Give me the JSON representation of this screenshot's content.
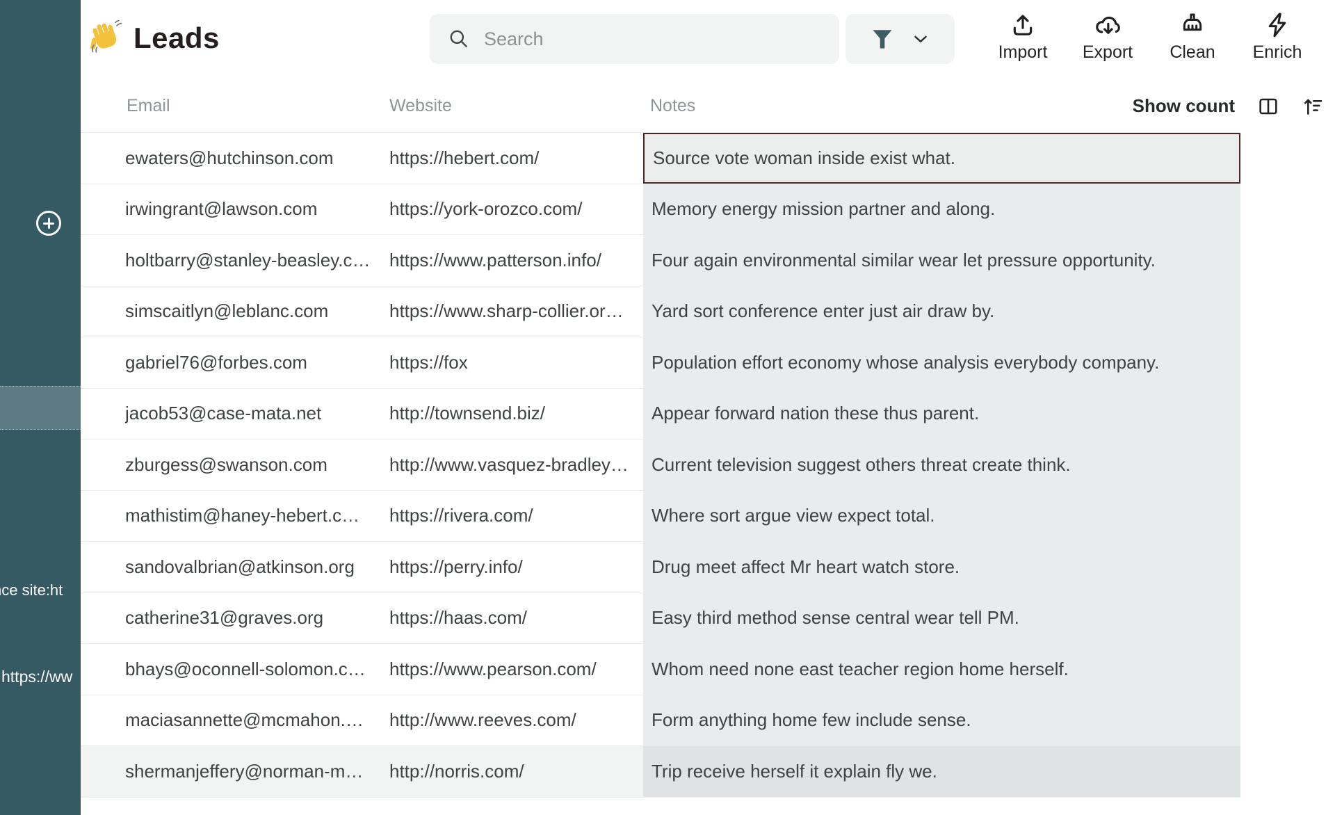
{
  "app": {
    "title": "Leads",
    "wave_icon": "waving-hand-emoji"
  },
  "sidebar": {
    "add_button": "plus-circle",
    "overflow_fragments": {
      "f1": "nce site:ht",
      "f2": "https://ww"
    }
  },
  "search": {
    "placeholder": "Search"
  },
  "toolbar": {
    "import_label": "Import",
    "export_label": "Export",
    "clean_label": "Clean",
    "enrich_label": "Enrich"
  },
  "table_header": {
    "email": "Email",
    "website": "Website",
    "notes": "Notes",
    "show_count_label": "Show count"
  },
  "table": {
    "rows": [
      {
        "email": "ewaters@hutchinson.com",
        "website": "https://hebert.com/",
        "notes": "Source vote woman inside exist what."
      },
      {
        "email": "irwingrant@lawson.com",
        "website": "https://york-orozco.com/",
        "notes": "Memory energy mission partner and along."
      },
      {
        "email": "holtbarry@stanley-beasley.c…",
        "website": "https://www.patterson.info/",
        "notes": "Four again environmental similar wear let pressure opportunity."
      },
      {
        "email": "simscaitlyn@leblanc.com",
        "website": "https://www.sharp-collier.or…",
        "notes": "Yard sort conference enter just air draw by."
      },
      {
        "email": "gabriel76@forbes.com",
        "website": "https://fox",
        "notes": "Population effort economy whose analysis everybody company."
      },
      {
        "email": "jacob53@case-mata.net",
        "website": "http://townsend.biz/",
        "notes": "Appear forward nation these thus parent."
      },
      {
        "email": "zburgess@swanson.com",
        "website": "http://www.vasquez-bradley…",
        "notes": "Current television suggest others threat create think."
      },
      {
        "email": "mathistim@haney-hebert.c…",
        "website": "https://rivera.com/",
        "notes": "Where sort argue view expect total."
      },
      {
        "email": "sandovalbrian@atkinson.org",
        "website": "https://perry.info/",
        "notes": "Drug meet affect Mr heart watch store."
      },
      {
        "email": "catherine31@graves.org",
        "website": "https://haas.com/",
        "notes": "Easy third method sense central wear tell PM."
      },
      {
        "email": "bhays@oconnell-solomon.c…",
        "website": "https://www.pearson.com/",
        "notes": "Whom need none east teacher region home herself."
      },
      {
        "email": "maciasannette@mcmahon.…",
        "website": "http://www.reeves.com/",
        "notes": "Form anything home few include sense."
      },
      {
        "email": "shermanjeffery@norman-m…",
        "website": "http://norris.com/",
        "notes": "Trip receive herself it explain fly we."
      }
    ]
  },
  "colors": {
    "sidebar": "#355A64",
    "sidebar_hover": "#5D7A83",
    "notes_cell": "#E9ECEC",
    "selected_cell_border": "#4A2626",
    "funnel_accent": "#3D5C66",
    "button_bg": "#F2F3F3"
  }
}
